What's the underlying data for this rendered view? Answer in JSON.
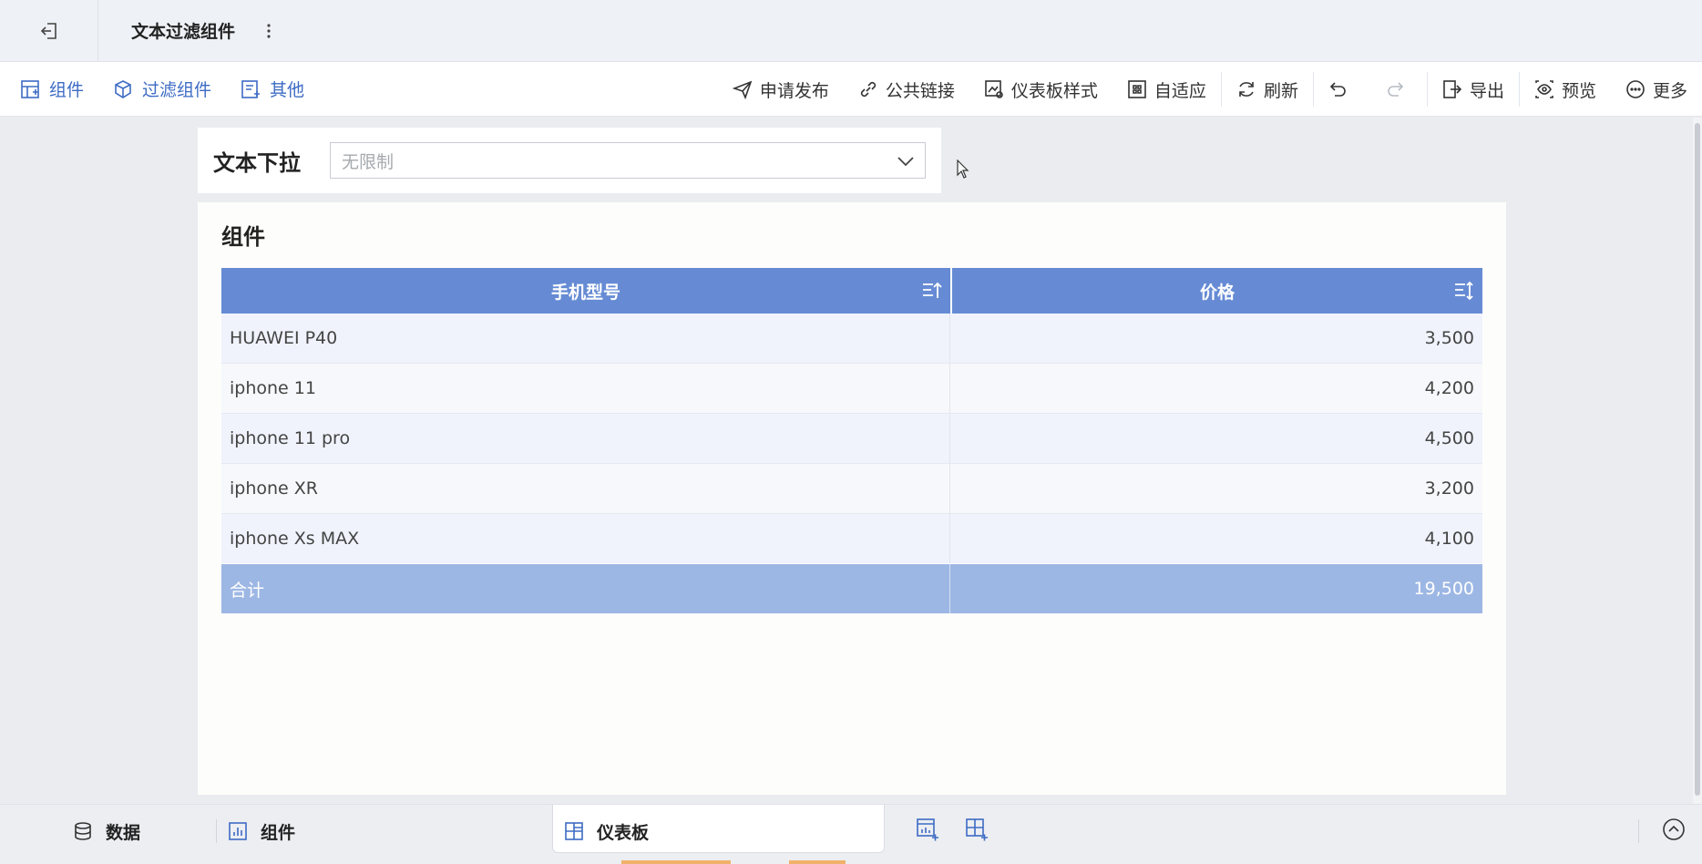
{
  "header": {
    "title": "文本过滤组件"
  },
  "toolbar": {
    "left": [
      {
        "label": "组件",
        "icon": "add-component-icon"
      },
      {
        "label": "过滤组件",
        "icon": "filter-component-icon"
      },
      {
        "label": "其他",
        "icon": "other-icon"
      }
    ],
    "right": {
      "publish": "申请发布",
      "public_link": "公共链接",
      "dashboard_style": "仪表板样式",
      "adaptive": "自适应",
      "refresh": "刷新",
      "export": "导出",
      "preview": "预览",
      "more": "更多"
    }
  },
  "filter_widget": {
    "label": "文本下拉",
    "select_value": "无限制"
  },
  "table_widget": {
    "title": "组件",
    "columns": [
      "手机型号",
      "价格"
    ],
    "rows": [
      [
        "HUAWEI P40",
        "3,500"
      ],
      [
        "iphone 11",
        "4,200"
      ],
      [
        "iphone 11 pro",
        "4,500"
      ],
      [
        "iphone XR",
        "3,200"
      ],
      [
        "iphone Xs MAX",
        "4,100"
      ]
    ],
    "total": [
      "合计",
      "19,500"
    ]
  },
  "bottombar": {
    "data": "数据",
    "component": "组件",
    "dashboard": "仪表板"
  },
  "colors": {
    "accent": "#3d6bc4",
    "table_header": "#668bd4",
    "table_total": "#9db7e4"
  }
}
